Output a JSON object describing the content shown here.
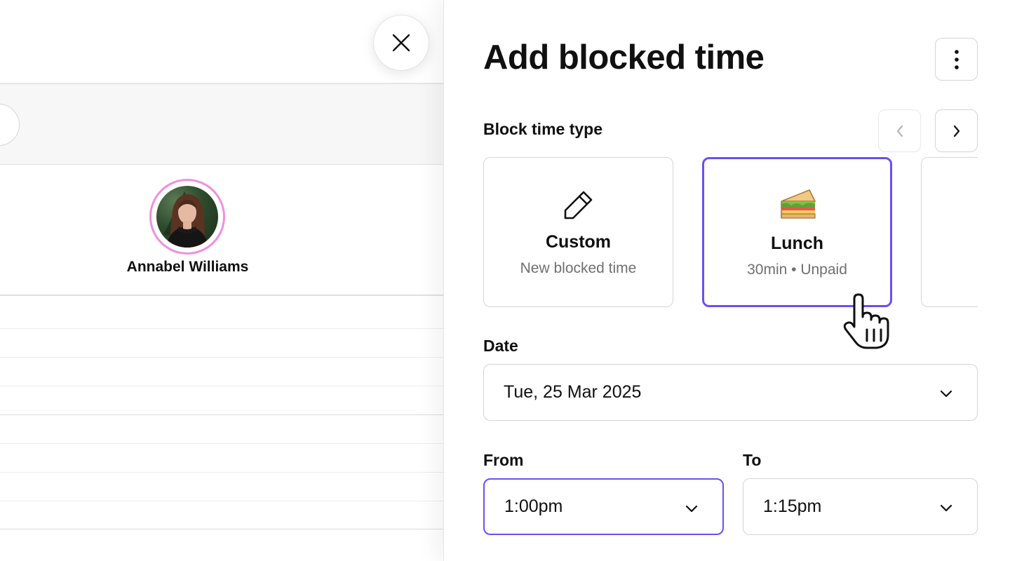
{
  "calendar": {
    "staff_name": "Annabel Williams"
  },
  "panel": {
    "title": "Add blocked time",
    "block_type_label": "Block time type",
    "cards": [
      {
        "title": "Custom",
        "subtitle": "New blocked time",
        "icon": "pencil-icon",
        "selected": false
      },
      {
        "title": "Lunch",
        "subtitle": "30min • Unpaid",
        "icon": "sandwich-icon",
        "selected": true
      }
    ],
    "date_label": "Date",
    "date_value": "Tue, 25 Mar 2025",
    "from_label": "From",
    "from_value": "1:00pm",
    "to_label": "To",
    "to_value": "1:15pm"
  },
  "colors": {
    "accent": "#6950f3",
    "avatar_ring": "#f08fe0",
    "muted_text": "#707070",
    "border": "#d4d4d4"
  }
}
